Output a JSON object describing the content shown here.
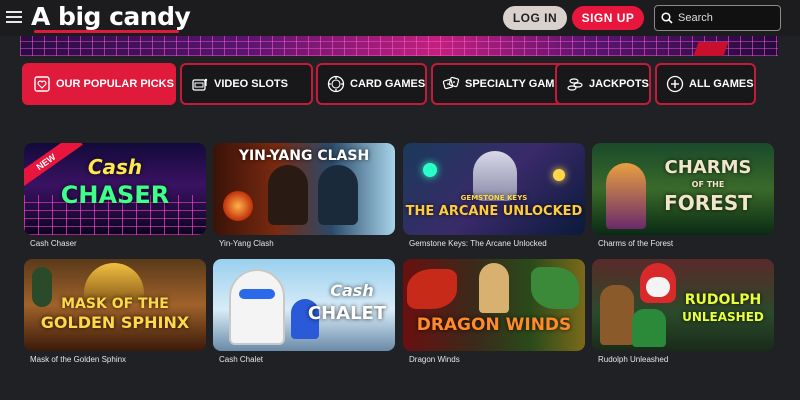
{
  "header": {
    "logo": "A big candy",
    "login_label": "LOG IN",
    "signup_label": "SIGN UP",
    "search_placeholder": "Search"
  },
  "tabs": [
    {
      "label": "OUR POPULAR PICKS",
      "icon": "heart-icon",
      "active": true
    },
    {
      "label": "VIDEO SLOTS",
      "icon": "slot-machine-icon",
      "active": false
    },
    {
      "label": "CARD GAMES",
      "icon": "poker-chip-icon",
      "active": false
    },
    {
      "label": "SPECIALTY GAMES",
      "icon": "dice-icon",
      "active": false
    },
    {
      "label": "JACKPOTS",
      "icon": "coins-icon",
      "active": false
    },
    {
      "label": "ALL GAMES",
      "icon": "plus-circle-icon",
      "active": false
    }
  ],
  "games": [
    {
      "name": "Cash Chaser",
      "title": "Cash CHASER",
      "badge": "NEW"
    },
    {
      "name": "Yin-Yang Clash",
      "title": "YIN-YANG CLASH"
    },
    {
      "name": "Gemstone Keys: The Arcane Unlocked",
      "title": "THE ARCANE UNLOCKED",
      "subtitle": "GEMSTONE KEYS"
    },
    {
      "name": "Charms of the Forest",
      "title": "CHARMS OF THE FOREST"
    },
    {
      "name": "Mask of the Golden Sphinx",
      "title": "MASK OF THE GOLDEN SPHINX"
    },
    {
      "name": "Cash Chalet",
      "title": "Cash CHALET"
    },
    {
      "name": "Dragon Winds",
      "title": "DRAGON WINDS"
    },
    {
      "name": "Rudolph Unleashed",
      "title": "RUDOLPH UNLEASHED"
    }
  ],
  "colors": {
    "accent": "#e01a3b",
    "background": "#202124",
    "header": "#1c1c1f"
  }
}
